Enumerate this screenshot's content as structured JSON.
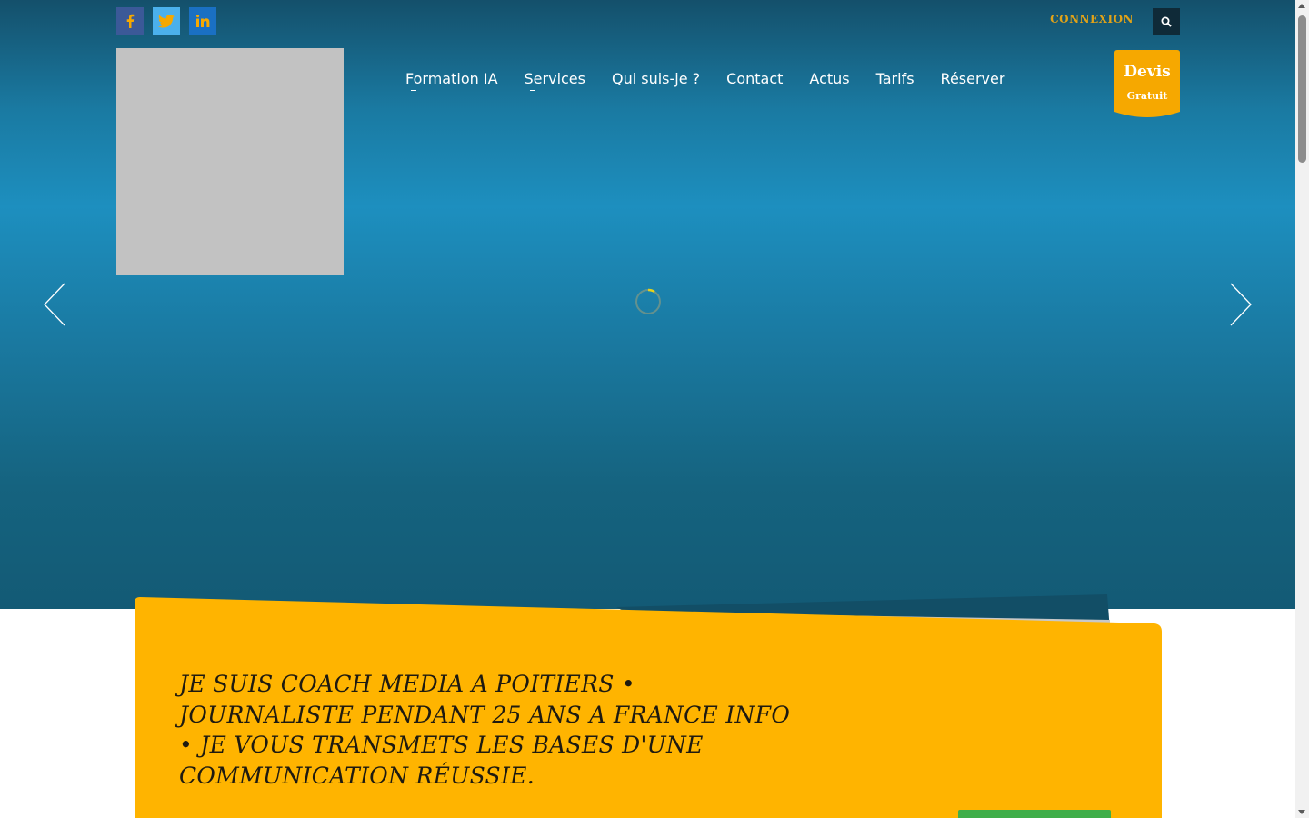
{
  "header": {
    "social": [
      {
        "name": "facebook",
        "icon": "facebook-icon",
        "color": "#3b5998"
      },
      {
        "name": "twitter",
        "icon": "twitter-icon",
        "color": "#4bb0ec"
      },
      {
        "name": "linkedin",
        "icon": "linkedin-icon",
        "color": "#1a70c3"
      }
    ],
    "login_label": "CONNEXION",
    "search_icon": "search-icon"
  },
  "nav": {
    "items": [
      {
        "label": "Formation IA"
      },
      {
        "label": "Services"
      },
      {
        "label": "Qui suis-je ?"
      },
      {
        "label": "Contact"
      },
      {
        "label": "Actus"
      },
      {
        "label": "Tarifs"
      },
      {
        "label": "Réserver"
      }
    ]
  },
  "cta": {
    "title": "Devis",
    "subtitle": "Gratuit",
    "color": "#f6a800"
  },
  "slider": {
    "prev_icon": "chevron-left-icon",
    "next_icon": "chevron-right-icon",
    "loading_icon": "spinner-icon"
  },
  "banner": {
    "text": "Je suis coach media a Poitiers • journaliste pendant 25 ans a France Info • je vous transmets les bases d'une communication réussie.",
    "color": "#ffb400"
  },
  "colors": {
    "accent": "#f6a800",
    "hero_blue": "#1d8fbf",
    "green": "#3fae49"
  }
}
